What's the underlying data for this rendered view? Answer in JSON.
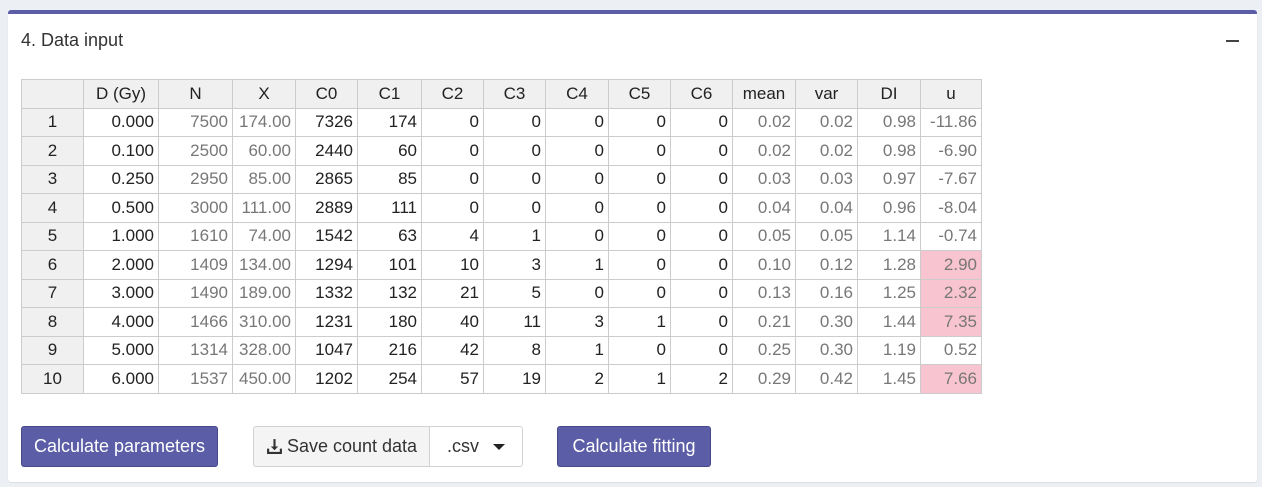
{
  "box": {
    "title": "4. Data input"
  },
  "table": {
    "headers": [
      "",
      "D (Gy)",
      "N",
      "X",
      "C0",
      "C1",
      "C2",
      "C3",
      "C4",
      "C5",
      "C6",
      "mean",
      "var",
      "DI",
      "u"
    ],
    "rows": [
      [
        "1",
        "0.000",
        "7500",
        "174.00",
        "7326",
        "174",
        "0",
        "0",
        "0",
        "0",
        "0",
        "0.02",
        "0.02",
        "0.98",
        "-11.86"
      ],
      [
        "2",
        "0.100",
        "2500",
        "60.00",
        "2440",
        "60",
        "0",
        "0",
        "0",
        "0",
        "0",
        "0.02",
        "0.02",
        "0.98",
        "-6.90"
      ],
      [
        "3",
        "0.250",
        "2950",
        "85.00",
        "2865",
        "85",
        "0",
        "0",
        "0",
        "0",
        "0",
        "0.03",
        "0.03",
        "0.97",
        "-7.67"
      ],
      [
        "4",
        "0.500",
        "3000",
        "111.00",
        "2889",
        "111",
        "0",
        "0",
        "0",
        "0",
        "0",
        "0.04",
        "0.04",
        "0.96",
        "-8.04"
      ],
      [
        "5",
        "1.000",
        "1610",
        "74.00",
        "1542",
        "63",
        "4",
        "1",
        "0",
        "0",
        "0",
        "0.05",
        "0.05",
        "1.14",
        "-0.74"
      ],
      [
        "6",
        "2.000",
        "1409",
        "134.00",
        "1294",
        "101",
        "10",
        "3",
        "1",
        "0",
        "0",
        "0.10",
        "0.12",
        "1.28",
        "2.90"
      ],
      [
        "7",
        "3.000",
        "1490",
        "189.00",
        "1332",
        "132",
        "21",
        "5",
        "0",
        "0",
        "0",
        "0.13",
        "0.16",
        "1.25",
        "2.32"
      ],
      [
        "8",
        "4.000",
        "1466",
        "310.00",
        "1231",
        "180",
        "40",
        "11",
        "3",
        "1",
        "0",
        "0.21",
        "0.30",
        "1.44",
        "7.35"
      ],
      [
        "9",
        "5.000",
        "1314",
        "328.00",
        "1047",
        "216",
        "42",
        "8",
        "1",
        "0",
        "0",
        "0.25",
        "0.30",
        "1.19",
        "0.52"
      ],
      [
        "10",
        "6.000",
        "1537",
        "450.00",
        "1202",
        "254",
        "57",
        "19",
        "2",
        "1",
        "2",
        "0.29",
        "0.42",
        "1.45",
        "7.66"
      ]
    ],
    "highlight_color": "#f8c4cf",
    "readonly_color": "#777777"
  },
  "buttons": {
    "calculate_parameters": "Calculate parameters",
    "save_count_data": "Save count data",
    "format_selected": ".csv",
    "calculate_fitting": "Calculate fitting"
  },
  "colors": {
    "accent": "#5b5ea6"
  }
}
